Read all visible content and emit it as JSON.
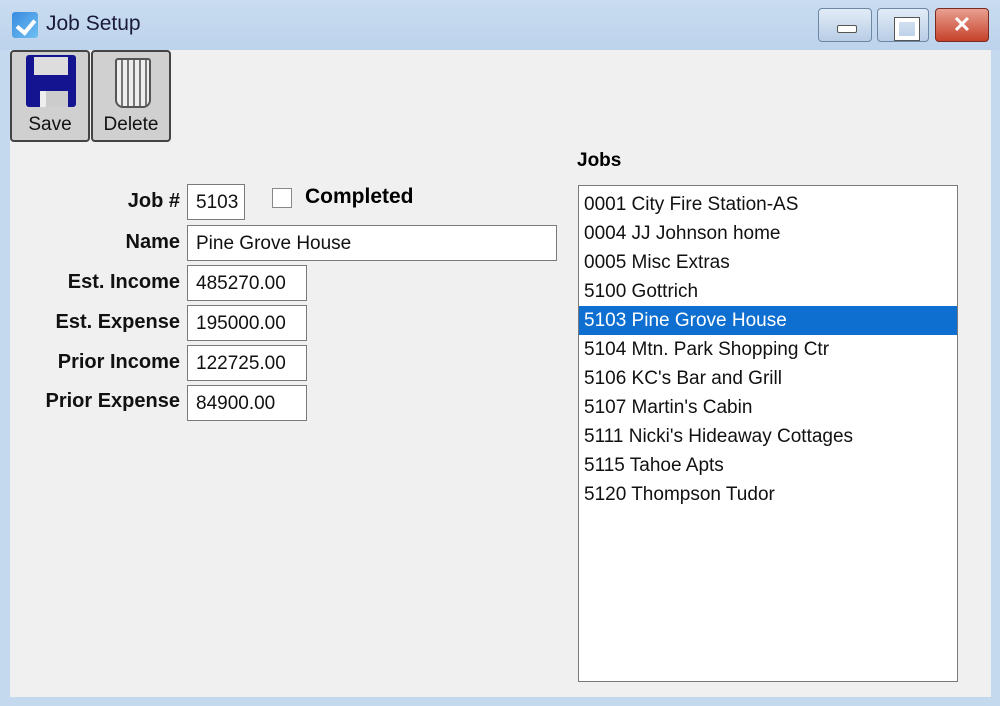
{
  "window": {
    "title": "Job Setup",
    "icon": "app-icon"
  },
  "toolbar": {
    "save_label": "Save",
    "delete_label": "Delete"
  },
  "form": {
    "job_no_label": "Job #",
    "job_no": "5103",
    "completed_label": "Completed",
    "completed": false,
    "name_label": "Name",
    "name": "Pine Grove House",
    "est_income_label": "Est. Income",
    "est_income": "485270.00",
    "est_expense_label": "Est. Expense",
    "est_expense": "195000.00",
    "prior_income_label": "Prior Income",
    "prior_income": "122725.00",
    "prior_expense_label": "Prior Expense",
    "prior_expense": "84900.00"
  },
  "jobs": {
    "label": "Jobs",
    "selected_index": 4,
    "items": [
      "0001 City Fire Station-AS",
      "0004 JJ Johnson home",
      "0005 Misc Extras",
      "5100 Gottrich",
      "5103 Pine Grove House",
      "5104 Mtn. Park Shopping Ctr",
      "5106 KC's Bar and Grill",
      "5107 Martin's Cabin",
      "5111 Nicki's Hideaway Cottages",
      "5115 Tahoe Apts",
      "5120 Thompson Tudor"
    ]
  },
  "colors": {
    "selection": "#0e6fd1",
    "close_button": "#c5412a"
  }
}
